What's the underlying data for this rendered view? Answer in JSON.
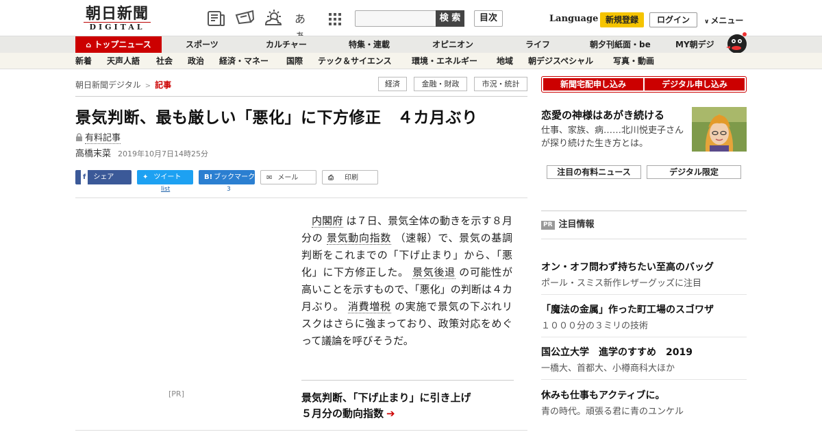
{
  "header": {
    "logo_main": "朝日新聞",
    "logo_sub": "DIGITAL",
    "icons": [
      "newspaper-icon",
      "megaphone-icon",
      "weather-icon",
      "font-size-icon",
      "grid-menu-icon"
    ],
    "font_size_label": "あぁ",
    "search_button": "検 索",
    "search_placeholder": "",
    "toc_button": "目次",
    "language": "Language",
    "signup": "新規登録",
    "login": "ログイン",
    "menu": "メニュー"
  },
  "mainnav": {
    "items": [
      "トップニュース",
      "スポーツ",
      "カルチャー",
      "特集・連載",
      "オピニオン",
      "ライフ",
      "朝夕刊紙面・be",
      "MY朝デジ"
    ]
  },
  "subnav": {
    "items": [
      "新着",
      "天声人語",
      "社会",
      "政治",
      "経済・マネー",
      "国際",
      "テック＆サイエンス",
      "環境・エネルギー",
      "地域",
      "朝デジスペシャル",
      "写真・動画"
    ]
  },
  "breadcrumb": {
    "home": "朝日新聞デジタル",
    "sep": ">",
    "current": "記事"
  },
  "tags": [
    "経済",
    "金融・財政",
    "市況・統計"
  ],
  "article": {
    "headline": "景気判断、最も厳しい「悪化」に下方修正　４カ月ぶり",
    "paid_label": "有料記事",
    "author": "高橋末菜",
    "date": "2019年10月7日14時25分",
    "body": [
      {
        "t": "内閣府",
        "link": true
      },
      {
        "t": " は７日、景気全体の動きを示す８月分の ",
        "link": false
      },
      {
        "t": "景気動向指数",
        "link": true
      },
      {
        "t": " （速報）で、景気の基調判断をこれまでの「下げ止まり」から、「悪化」に下方修正した。 ",
        "link": false
      },
      {
        "t": "景気後退",
        "link": true
      },
      {
        "t": " の可能性が高いことを示すもので、「悪化」の判断は４カ月ぶり。 ",
        "link": false
      },
      {
        "t": "消費増税",
        "link": true
      },
      {
        "t": " の実施で景気の下ぶれリスクはさらに強まっており、政策対応をめぐって議論を呼びそうだ。",
        "link": false
      }
    ],
    "related_line1": "景気判断、「下げ止まり」に引き上げ",
    "related_line2": "５月分の動向指数",
    "arrow": "➔"
  },
  "share": {
    "facebook": "シェア",
    "twitter": "ツイート",
    "hatena": "ブックマーク",
    "hatena_icon": "B!",
    "mail": "メール",
    "print": "印刷",
    "twitter_count": "list",
    "hatena_count": "3"
  },
  "ad_label": "[PR]",
  "sidebar": {
    "subscribe_paper": "新聞宅配申し込み",
    "subscribe_digital": "デジタル申し込み",
    "feature_title": "恋愛の神様はあがき続ける",
    "feature_desc": "仕事、家族、病……北川悦吏子さんが探り続けた生き方とは。",
    "btn_paid_news": "注目の有料ニュース",
    "btn_digital_only": "デジタル限定",
    "pr_tag": "PR",
    "notice_title": "注目情報",
    "pr_items": [
      {
        "title": "オン・オフ問わず持ちたい至高のバッグ",
        "sub": "ポール・スミス新作レザーグッズに注目"
      },
      {
        "title": "「魔法の金属」作った町工場のスゴワザ",
        "sub": "１０００分の３ミリの技術"
      },
      {
        "title": "国公立大学　進学のすすめ　2019",
        "sub": "一橋大、首都大、小樽商科大ほか"
      },
      {
        "title": "休みも仕事もアクティブに。",
        "sub": "青の時代。頑張る君に青のユンケル"
      }
    ]
  },
  "colors": {
    "brand_red": "#cc0000",
    "signup_yellow": "#f5c400",
    "facebook": "#3b5998",
    "twitter": "#1da1f2",
    "hatena": "#2b7fd1"
  }
}
